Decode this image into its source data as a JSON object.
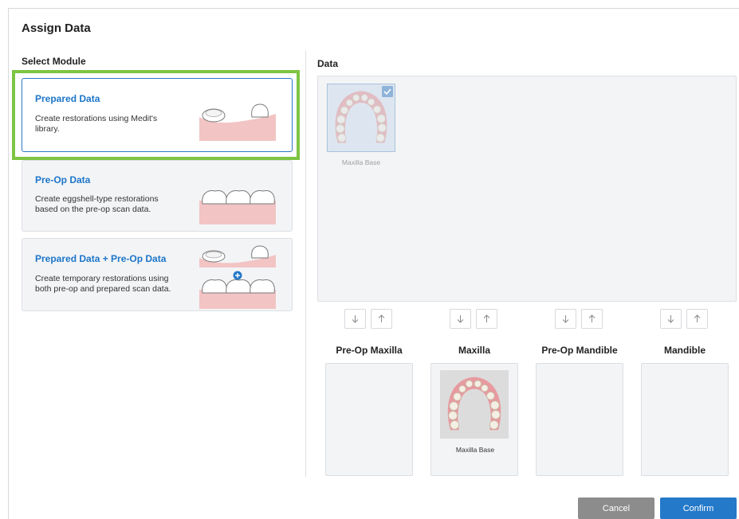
{
  "dialog": {
    "title": "Assign Data"
  },
  "left": {
    "section_label": "Select Module",
    "modules": [
      {
        "title": "Prepared Data",
        "description": "Create restorations using Medit's library.",
        "selected": true
      },
      {
        "title": "Pre-Op Data",
        "description": "Create eggshell-type restorations based on the pre-op scan data.",
        "selected": false
      },
      {
        "title": "Prepared Data + Pre-Op Data",
        "description": "Create temporary restorations using both pre-op and prepared scan data.",
        "selected": false
      }
    ]
  },
  "right": {
    "section_label": "Data",
    "data_items": [
      {
        "label": "Maxilla Base",
        "checked": true
      }
    ],
    "slots": [
      {
        "label": "Pre-Op Maxilla",
        "item": ""
      },
      {
        "label": "Maxilla",
        "item": "Maxilla Base"
      },
      {
        "label": "Pre-Op Mandible",
        "item": ""
      },
      {
        "label": "Mandible",
        "item": ""
      }
    ]
  },
  "footer": {
    "cancel_label": "Cancel",
    "confirm_label": "Confirm"
  },
  "colors": {
    "accent": "#2479c9",
    "highlight": "#7dc443",
    "cancel": "#8c8c8c",
    "gum": "#f2b8ba"
  }
}
